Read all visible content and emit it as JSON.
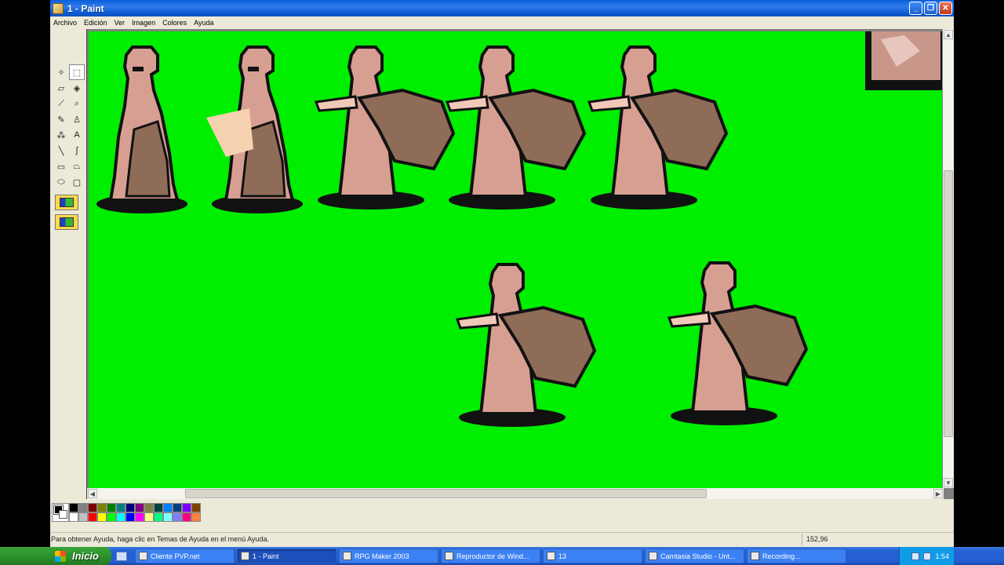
{
  "window": {
    "title": "1 - Paint"
  },
  "menu": [
    "Archivo",
    "Edición",
    "Ver",
    "Imagen",
    "Colores",
    "Ayuda"
  ],
  "tools": [
    {
      "name": "free-select-icon",
      "glyph": "✧"
    },
    {
      "name": "rect-select-icon",
      "glyph": "⬚"
    },
    {
      "name": "eraser-icon",
      "glyph": "▱"
    },
    {
      "name": "fill-bucket-icon",
      "glyph": "◈"
    },
    {
      "name": "color-picker-icon",
      "glyph": "⟋"
    },
    {
      "name": "magnifier-icon",
      "glyph": "⌕"
    },
    {
      "name": "pencil-icon",
      "glyph": "✎"
    },
    {
      "name": "brush-icon",
      "glyph": "♙"
    },
    {
      "name": "airbrush-icon",
      "glyph": "⁂"
    },
    {
      "name": "text-icon",
      "glyph": "A"
    },
    {
      "name": "line-icon",
      "glyph": "╲"
    },
    {
      "name": "curve-icon",
      "glyph": "∫"
    },
    {
      "name": "rectangle-icon",
      "glyph": "▭"
    },
    {
      "name": "polygon-icon",
      "glyph": "⏢"
    },
    {
      "name": "ellipse-icon",
      "glyph": "⬭"
    },
    {
      "name": "rounded-rect-icon",
      "glyph": "▢"
    }
  ],
  "palette": {
    "colors": [
      "#000000",
      "#808080",
      "#800000",
      "#808000",
      "#008000",
      "#008080",
      "#000080",
      "#800080",
      "#808040",
      "#004040",
      "#0080ff",
      "#004080",
      "#8000ff",
      "#804000",
      "#ffffff",
      "#c0c0c0",
      "#ff0000",
      "#ffff00",
      "#00ff00",
      "#00ffff",
      "#0000ff",
      "#ff00ff",
      "#ffff80",
      "#00ff80",
      "#80ffff",
      "#8080ff",
      "#ff0080",
      "#ff8040"
    ]
  },
  "status": {
    "help": "Para obtener Ayuda, haga clic en Temas de Ayuda en el menú Ayuda.",
    "coords": "152,96"
  },
  "taskbar": {
    "start_label": "Inicio",
    "tasks": [
      {
        "label": "Cliente PVP.net"
      },
      {
        "label": "1 - Paint"
      },
      {
        "label": "RPG Maker 2003"
      },
      {
        "label": "Reproductor de Wind..."
      },
      {
        "label": "13"
      },
      {
        "label": "Camtasia Studio - Unt..."
      },
      {
        "label": "Recording..."
      }
    ],
    "clock": "1:54"
  }
}
